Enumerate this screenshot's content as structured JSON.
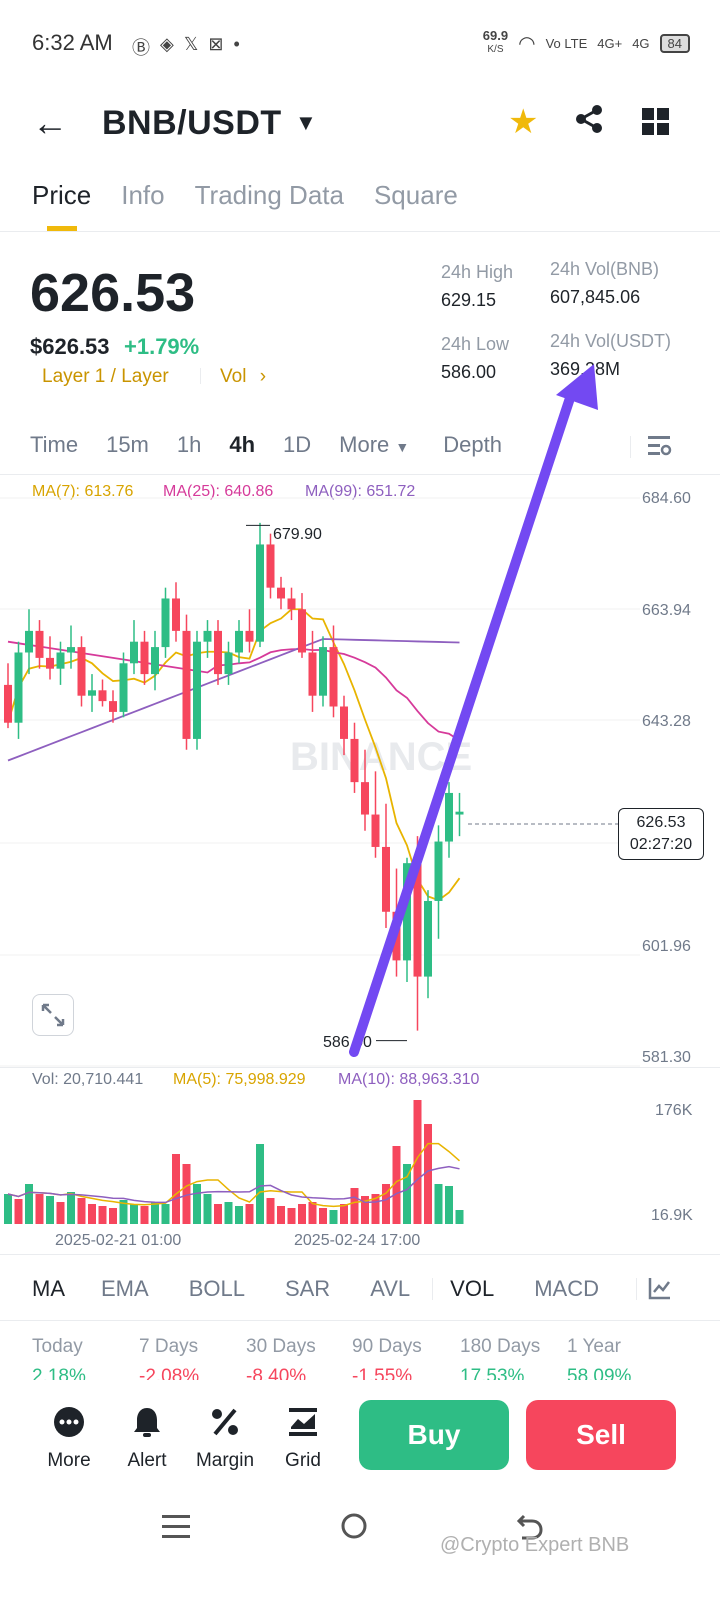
{
  "status_bar": {
    "time": "6:32 AM",
    "speed": "69.9",
    "speed_unit": "K/S",
    "network1": "Vo LTE",
    "network2": "4G+",
    "network3": "4G",
    "battery": "84"
  },
  "header": {
    "pair": "BNB/USDT"
  },
  "tabs": [
    "Price",
    "Info",
    "Trading Data",
    "Square"
  ],
  "price": {
    "last": "626.53",
    "usd": "$626.53",
    "change": "+1.79%",
    "tag": "Layer 1 / Layer",
    "vol_link": "Vol"
  },
  "stats": {
    "high_label": "24h High",
    "high": "629.15",
    "low_label": "24h Low",
    "low": "586.00",
    "vol_bnb_label": "24h Vol(BNB)",
    "vol_bnb": "607,845.06",
    "vol_usdt_label": "24h Vol(USDT)",
    "vol_usdt": "369.28M"
  },
  "intervals": [
    "Time",
    "15m",
    "1h",
    "4h",
    "1D",
    "More",
    "Depth"
  ],
  "ma": {
    "ma7": "MA(7): 613.76",
    "ma25": "MA(25): 640.86",
    "ma99": "MA(99): 651.72"
  },
  "vol_ma": {
    "vol": "Vol: 20,710.441",
    "ma5": "MA(5): 75,998.929",
    "ma10": "MA(10): 88,963.310"
  },
  "chart_labels": {
    "high_marker": "679.90",
    "low_marker": "586.00",
    "current": "626.53",
    "countdown": "02:27:20",
    "watermark": "BINANCE"
  },
  "chart_data": {
    "type": "candlestick",
    "price_axis": [
      "684.60",
      "663.94",
      "643.28",
      "626.53",
      "601.96",
      "581.30"
    ],
    "ylim": [
      581.3,
      684.6
    ],
    "volume_axis": [
      "176K",
      "16.9K"
    ],
    "x_ticks": [
      "2025-02-21 01:00",
      "2025-02-24 17:00"
    ],
    "series": [
      {
        "name": "MA(7)",
        "color": "#f0b90b"
      },
      {
        "name": "MA(25)",
        "color": "#d63a9a"
      },
      {
        "name": "MA(99)",
        "color": "#8e5fbf"
      }
    ],
    "candles": [
      [
        650,
        654,
        642,
        643
      ],
      [
        643,
        658,
        640,
        656
      ],
      [
        656,
        664,
        652,
        660
      ],
      [
        660,
        662,
        653,
        655
      ],
      [
        655,
        659,
        651,
        653
      ],
      [
        653,
        658,
        650,
        656
      ],
      [
        656,
        661,
        653,
        657
      ],
      [
        657,
        659,
        646,
        648
      ],
      [
        648,
        652,
        645,
        649
      ],
      [
        649,
        651,
        646,
        647
      ],
      [
        647,
        649,
        643,
        645
      ],
      [
        645,
        656,
        644,
        654
      ],
      [
        654,
        662,
        652,
        658
      ],
      [
        658,
        660,
        650,
        652
      ],
      [
        652,
        660,
        649,
        657
      ],
      [
        657,
        668,
        655,
        666
      ],
      [
        666,
        669,
        658,
        660
      ],
      [
        660,
        663,
        638,
        640
      ],
      [
        640,
        660,
        638,
        658
      ],
      [
        658,
        662,
        655,
        660
      ],
      [
        660,
        662,
        650,
        652
      ],
      [
        652,
        658,
        650,
        656
      ],
      [
        656,
        662,
        654,
        660
      ],
      [
        660,
        664,
        656,
        658
      ],
      [
        658,
        680,
        657,
        676
      ],
      [
        676,
        678,
        666,
        668
      ],
      [
        668,
        670,
        664,
        666
      ],
      [
        666,
        668,
        662,
        664
      ],
      [
        664,
        667,
        655,
        656
      ],
      [
        656,
        660,
        645,
        648
      ],
      [
        648,
        659,
        646,
        657
      ],
      [
        657,
        661,
        644,
        646
      ],
      [
        646,
        648,
        637,
        640
      ],
      [
        640,
        643,
        630,
        632
      ],
      [
        632,
        638,
        623,
        626
      ],
      [
        626,
        634,
        618,
        620
      ],
      [
        620,
        628,
        605,
        608
      ],
      [
        608,
        616,
        596,
        599
      ],
      [
        599,
        618,
        595,
        617
      ],
      [
        617,
        622,
        586,
        596
      ],
      [
        596,
        612,
        592,
        610
      ],
      [
        610,
        624,
        603,
        621
      ],
      [
        621,
        632,
        618,
        630
      ],
      [
        626,
        630,
        622,
        626.53
      ]
    ],
    "volumes": [
      [
        30,
        "g"
      ],
      [
        25,
        "r"
      ],
      [
        40,
        "g"
      ],
      [
        30,
        "r"
      ],
      [
        28,
        "g"
      ],
      [
        22,
        "r"
      ],
      [
        32,
        "g"
      ],
      [
        26,
        "r"
      ],
      [
        20,
        "r"
      ],
      [
        18,
        "r"
      ],
      [
        16,
        "r"
      ],
      [
        24,
        "g"
      ],
      [
        20,
        "g"
      ],
      [
        18,
        "r"
      ],
      [
        22,
        "g"
      ],
      [
        20,
        "g"
      ],
      [
        70,
        "r"
      ],
      [
        60,
        "r"
      ],
      [
        40,
        "g"
      ],
      [
        30,
        "g"
      ],
      [
        20,
        "r"
      ],
      [
        22,
        "g"
      ],
      [
        18,
        "g"
      ],
      [
        20,
        "r"
      ],
      [
        80,
        "g"
      ],
      [
        26,
        "r"
      ],
      [
        18,
        "r"
      ],
      [
        16,
        "r"
      ],
      [
        20,
        "r"
      ],
      [
        22,
        "r"
      ],
      [
        16,
        "r"
      ],
      [
        14,
        "g"
      ],
      [
        20,
        "r"
      ],
      [
        36,
        "r"
      ],
      [
        28,
        "r"
      ],
      [
        30,
        "r"
      ],
      [
        40,
        "r"
      ],
      [
        78,
        "r"
      ],
      [
        60,
        "g"
      ],
      [
        124,
        "r"
      ],
      [
        100,
        "r"
      ],
      [
        40,
        "g"
      ],
      [
        38,
        "g"
      ],
      [
        14,
        "g"
      ]
    ]
  },
  "indicators": [
    "MA",
    "EMA",
    "BOLL",
    "SAR",
    "AVL",
    "VOL",
    "MACD"
  ],
  "performance": {
    "labels": [
      "Today",
      "7 Days",
      "30 Days",
      "90 Days",
      "180 Days",
      "1 Year"
    ],
    "values": [
      "2.18%",
      "-2.08%",
      "-8.40%",
      "-1.55%",
      "17.53%",
      "58.09%"
    ]
  },
  "bottom": {
    "more": "More",
    "alert": "Alert",
    "margin": "Margin",
    "grid": "Grid",
    "buy": "Buy",
    "sell": "Sell"
  },
  "watermark": "@Crypto Expert BNB",
  "colors": {
    "up": "#2ebd85",
    "down": "#f6465d",
    "accent": "#f0b90b",
    "annotation_arrow": "#7349f2"
  }
}
